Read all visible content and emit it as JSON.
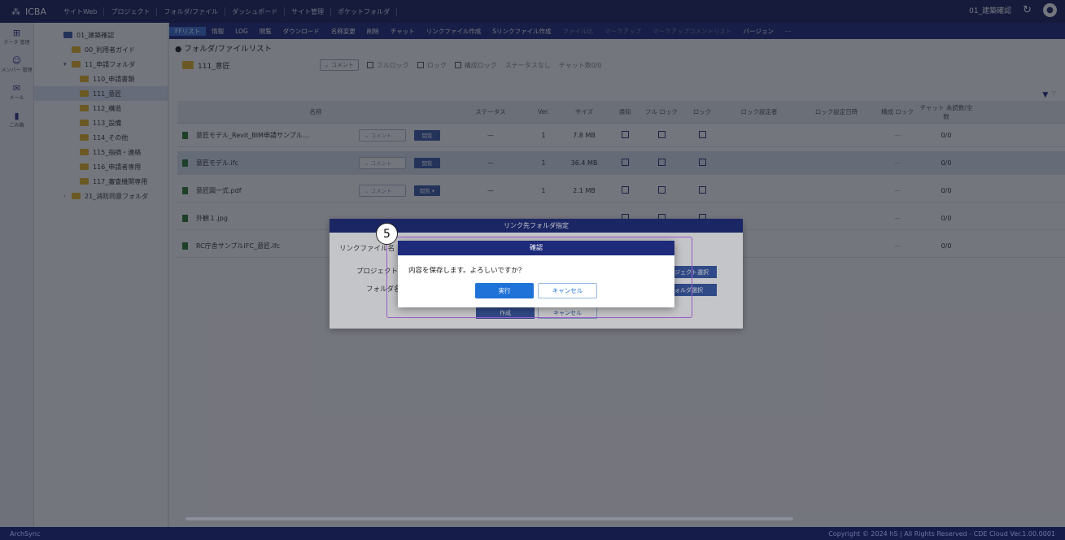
{
  "topbar": {
    "brand": "ICBA",
    "menus": [
      "サイトWeb",
      "プロジェクト",
      "フォルダ/ファイル",
      "ダッシュボード",
      "サイト管理",
      "ポケットフォルダ"
    ],
    "project_name": "01_建築確認"
  },
  "rail": [
    {
      "icon": "data-icon",
      "label": "データ 管理"
    },
    {
      "icon": "members-icon",
      "label": "メンバー 管理"
    },
    {
      "icon": "mail-icon",
      "label": "メール"
    },
    {
      "icon": "trash-icon",
      "label": "ごみ箱"
    }
  ],
  "tree": [
    {
      "label": "01_建築確認",
      "level": 0,
      "caret": ""
    },
    {
      "label": "00_利用者ガイド",
      "level": 1,
      "caret": ""
    },
    {
      "label": "11_申請フォルダ",
      "level": 1,
      "caret": "▾"
    },
    {
      "label": "110_申請書類",
      "level": 2,
      "caret": ""
    },
    {
      "label": "111_意匠",
      "level": 2,
      "caret": "",
      "selected": true
    },
    {
      "label": "112_構造",
      "level": 2,
      "caret": ""
    },
    {
      "label": "113_設備",
      "level": 2,
      "caret": ""
    },
    {
      "label": "114_その他",
      "level": 2,
      "caret": ""
    },
    {
      "label": "115_指摘・連絡",
      "level": 2,
      "caret": ""
    },
    {
      "label": "116_申請者専用",
      "level": 2,
      "caret": ""
    },
    {
      "label": "117_審査機関専用",
      "level": 2,
      "caret": ""
    },
    {
      "label": "21_消防同意フォルダ",
      "level": 1,
      "caret": "›"
    }
  ],
  "toolbar": [
    {
      "label": "FFリスト",
      "state": "active"
    },
    {
      "label": "情報",
      "state": "on"
    },
    {
      "label": "LOG",
      "state": "on"
    },
    {
      "label": "閲覧",
      "state": "on"
    },
    {
      "label": "ダウンロード",
      "state": "on"
    },
    {
      "label": "名称変更",
      "state": "on"
    },
    {
      "label": "削除",
      "state": "on"
    },
    {
      "label": "チャット",
      "state": "on"
    },
    {
      "label": "リンクファイル作成",
      "state": "on"
    },
    {
      "label": "Sリンクファイル作成",
      "state": "on"
    },
    {
      "label": "ファイル比",
      "state": "dis"
    },
    {
      "label": "マークアップ",
      "state": "dis"
    },
    {
      "label": "マークアップコメントリスト",
      "state": "dis"
    },
    {
      "label": "バージョン",
      "state": "on"
    },
    {
      "label": "⋯",
      "state": "on"
    }
  ],
  "breadcrumb": "● フォルダ/ファイルリスト",
  "current_folder": "111_意匠",
  "filter": {
    "comment_combo": "⌄ コメント",
    "full_lock": "フルロック",
    "lock": "ロック",
    "struct_lock": "構成ロック",
    "status": "ステータスなし",
    "chat_count": "チャット数0/0"
  },
  "columns": [
    "名称",
    "ステータス",
    "Ver.",
    "サイズ",
    "通知",
    "フル ロック",
    "ロック",
    "ロック設定者",
    "ロック設定日時",
    "構成 ロック",
    "チャット 未読数/全数"
  ],
  "rows": [
    {
      "name": "意匠モデル_Revit_BIM申請サンプル…",
      "comment": "⌄ コメント",
      "view": "閲覧",
      "status": "—",
      "ver": "1",
      "size": "7.8 MB",
      "constr": "—",
      "chat": "0/0"
    },
    {
      "name": "意匠モデル.ifc",
      "comment": "⌄ コメント",
      "view": "閲覧",
      "status": "—",
      "ver": "1",
      "size": "36.4 MB",
      "constr": "—",
      "chat": "0/0",
      "selected": true
    },
    {
      "name": "意匠図一式.pdf",
      "comment": "⌄ コメント",
      "view": "閲覧 ▾",
      "status": "—",
      "ver": "1",
      "size": "2.1 MB",
      "constr": "—",
      "chat": "0/0"
    },
    {
      "name": "外観１.jpg",
      "comment": "",
      "view": "",
      "status": "",
      "ver": "",
      "size": "",
      "constr": "—",
      "chat": "0/0"
    },
    {
      "name": "RC庁舎サンプルIFC_意匠.ifc",
      "comment": "",
      "view": "",
      "status": "",
      "ver": "",
      "size": "",
      "constr": "—",
      "chat": "0/0"
    }
  ],
  "link_dialog": {
    "title": "リンク先フォルダ指定",
    "label_file": "リンクファイル名",
    "label_project": "プロジェクト",
    "label_folder": "フォルダ名",
    "project_select": "プロジェクト選択",
    "folder_select": "フォルダ選択",
    "create": "作成",
    "cancel": "キャンセル"
  },
  "confirm_dialog": {
    "title": "確認",
    "message": "内容を保存します。よろしいですか？",
    "ok": "実行",
    "cancel": "キャンセル"
  },
  "step_number": "5",
  "footer": {
    "left": "ArchSync",
    "right": "Copyright © 2024 hS | All Rights Reserved - CDE Cloud Ver.1.00.0001"
  },
  "colors": {
    "navy": "#1b2360",
    "toolbar": "#1e2b7a",
    "primary": "#1e72d8",
    "folder": "#e7b928",
    "highlight": "#9a5bc8"
  }
}
